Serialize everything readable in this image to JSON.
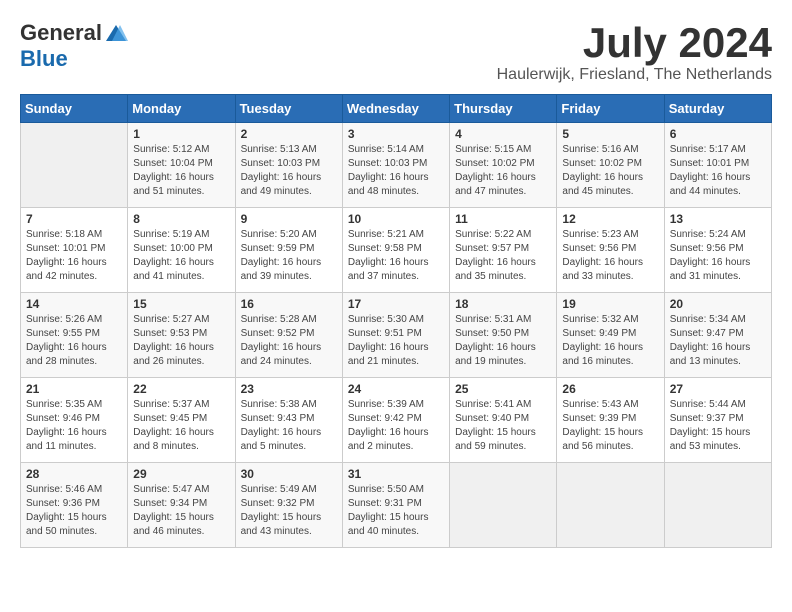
{
  "header": {
    "logo_general": "General",
    "logo_blue": "Blue",
    "month_year": "July 2024",
    "location": "Haulerwijk, Friesland, The Netherlands"
  },
  "columns": [
    "Sunday",
    "Monday",
    "Tuesday",
    "Wednesday",
    "Thursday",
    "Friday",
    "Saturday"
  ],
  "weeks": [
    [
      {
        "day": "",
        "info": ""
      },
      {
        "day": "1",
        "info": "Sunrise: 5:12 AM\nSunset: 10:04 PM\nDaylight: 16 hours\nand 51 minutes."
      },
      {
        "day": "2",
        "info": "Sunrise: 5:13 AM\nSunset: 10:03 PM\nDaylight: 16 hours\nand 49 minutes."
      },
      {
        "day": "3",
        "info": "Sunrise: 5:14 AM\nSunset: 10:03 PM\nDaylight: 16 hours\nand 48 minutes."
      },
      {
        "day": "4",
        "info": "Sunrise: 5:15 AM\nSunset: 10:02 PM\nDaylight: 16 hours\nand 47 minutes."
      },
      {
        "day": "5",
        "info": "Sunrise: 5:16 AM\nSunset: 10:02 PM\nDaylight: 16 hours\nand 45 minutes."
      },
      {
        "day": "6",
        "info": "Sunrise: 5:17 AM\nSunset: 10:01 PM\nDaylight: 16 hours\nand 44 minutes."
      }
    ],
    [
      {
        "day": "7",
        "info": "Sunrise: 5:18 AM\nSunset: 10:01 PM\nDaylight: 16 hours\nand 42 minutes."
      },
      {
        "day": "8",
        "info": "Sunrise: 5:19 AM\nSunset: 10:00 PM\nDaylight: 16 hours\nand 41 minutes."
      },
      {
        "day": "9",
        "info": "Sunrise: 5:20 AM\nSunset: 9:59 PM\nDaylight: 16 hours\nand 39 minutes."
      },
      {
        "day": "10",
        "info": "Sunrise: 5:21 AM\nSunset: 9:58 PM\nDaylight: 16 hours\nand 37 minutes."
      },
      {
        "day": "11",
        "info": "Sunrise: 5:22 AM\nSunset: 9:57 PM\nDaylight: 16 hours\nand 35 minutes."
      },
      {
        "day": "12",
        "info": "Sunrise: 5:23 AM\nSunset: 9:56 PM\nDaylight: 16 hours\nand 33 minutes."
      },
      {
        "day": "13",
        "info": "Sunrise: 5:24 AM\nSunset: 9:56 PM\nDaylight: 16 hours\nand 31 minutes."
      }
    ],
    [
      {
        "day": "14",
        "info": "Sunrise: 5:26 AM\nSunset: 9:55 PM\nDaylight: 16 hours\nand 28 minutes."
      },
      {
        "day": "15",
        "info": "Sunrise: 5:27 AM\nSunset: 9:53 PM\nDaylight: 16 hours\nand 26 minutes."
      },
      {
        "day": "16",
        "info": "Sunrise: 5:28 AM\nSunset: 9:52 PM\nDaylight: 16 hours\nand 24 minutes."
      },
      {
        "day": "17",
        "info": "Sunrise: 5:30 AM\nSunset: 9:51 PM\nDaylight: 16 hours\nand 21 minutes."
      },
      {
        "day": "18",
        "info": "Sunrise: 5:31 AM\nSunset: 9:50 PM\nDaylight: 16 hours\nand 19 minutes."
      },
      {
        "day": "19",
        "info": "Sunrise: 5:32 AM\nSunset: 9:49 PM\nDaylight: 16 hours\nand 16 minutes."
      },
      {
        "day": "20",
        "info": "Sunrise: 5:34 AM\nSunset: 9:47 PM\nDaylight: 16 hours\nand 13 minutes."
      }
    ],
    [
      {
        "day": "21",
        "info": "Sunrise: 5:35 AM\nSunset: 9:46 PM\nDaylight: 16 hours\nand 11 minutes."
      },
      {
        "day": "22",
        "info": "Sunrise: 5:37 AM\nSunset: 9:45 PM\nDaylight: 16 hours\nand 8 minutes."
      },
      {
        "day": "23",
        "info": "Sunrise: 5:38 AM\nSunset: 9:43 PM\nDaylight: 16 hours\nand 5 minutes."
      },
      {
        "day": "24",
        "info": "Sunrise: 5:39 AM\nSunset: 9:42 PM\nDaylight: 16 hours\nand 2 minutes."
      },
      {
        "day": "25",
        "info": "Sunrise: 5:41 AM\nSunset: 9:40 PM\nDaylight: 15 hours\nand 59 minutes."
      },
      {
        "day": "26",
        "info": "Sunrise: 5:43 AM\nSunset: 9:39 PM\nDaylight: 15 hours\nand 56 minutes."
      },
      {
        "day": "27",
        "info": "Sunrise: 5:44 AM\nSunset: 9:37 PM\nDaylight: 15 hours\nand 53 minutes."
      }
    ],
    [
      {
        "day": "28",
        "info": "Sunrise: 5:46 AM\nSunset: 9:36 PM\nDaylight: 15 hours\nand 50 minutes."
      },
      {
        "day": "29",
        "info": "Sunrise: 5:47 AM\nSunset: 9:34 PM\nDaylight: 15 hours\nand 46 minutes."
      },
      {
        "day": "30",
        "info": "Sunrise: 5:49 AM\nSunset: 9:32 PM\nDaylight: 15 hours\nand 43 minutes."
      },
      {
        "day": "31",
        "info": "Sunrise: 5:50 AM\nSunset: 9:31 PM\nDaylight: 15 hours\nand 40 minutes."
      },
      {
        "day": "",
        "info": ""
      },
      {
        "day": "",
        "info": ""
      },
      {
        "day": "",
        "info": ""
      }
    ]
  ]
}
